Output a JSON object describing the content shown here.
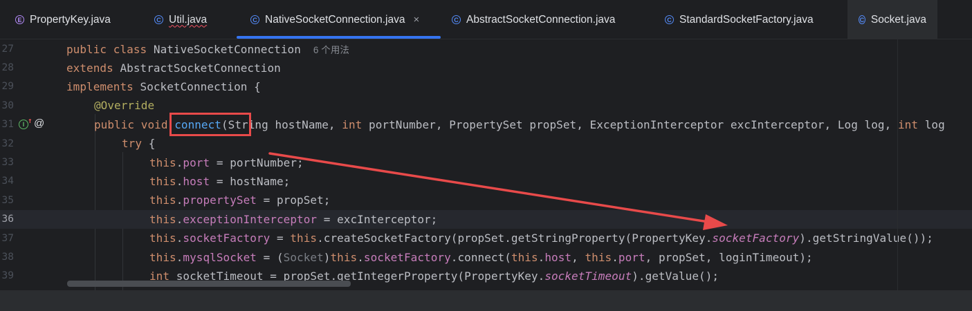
{
  "tabs": [
    {
      "label": "PropertyKey.java",
      "icon": "E",
      "kind": "enum"
    },
    {
      "label": "Util.java",
      "icon": "C",
      "kind": "class",
      "error": true
    },
    {
      "label": "NativeSocketConnection.java",
      "icon": "C",
      "kind": "class",
      "active": true,
      "close": "×"
    },
    {
      "label": "AbstractSocketConnection.java",
      "icon": "C",
      "kind": "class"
    },
    {
      "label": "StandardSocketFactory.java",
      "icon": "C",
      "kind": "class"
    },
    {
      "label": "Socket.java",
      "icon": "C",
      "kind": "class"
    }
  ],
  "gutter": {
    "implements_icon": "I",
    "override_marker": "↑",
    "annotation_icon": "@"
  },
  "hint_usages": "6 个用法",
  "lines": [
    {
      "num": "27",
      "t": {
        "a": "public class",
        "b": " NativeSocketConnection"
      }
    },
    {
      "num": "28",
      "t": {
        "a": "extends",
        "b": " AbstractSocketConnection"
      }
    },
    {
      "num": "29",
      "t": {
        "a": "implements",
        "b": " SocketConnection {"
      }
    },
    {
      "num": "30",
      "t": {
        "a": "@Override"
      }
    },
    {
      "num": "31",
      "t": {
        "a": "public void",
        "b": " ",
        "c": "connect",
        "d": "(String hostName, ",
        "e": "int",
        "f": " portNumber, PropertySet propSet, ExceptionInterceptor excInterceptor, Log log, ",
        "g": "int",
        "h": " log"
      }
    },
    {
      "num": "32",
      "t": {
        "a": "try",
        "b": " {"
      }
    },
    {
      "num": "33",
      "t": {
        "a": "this",
        "b": ".",
        "c": "port",
        "d": " = portNumber;"
      }
    },
    {
      "num": "34",
      "t": {
        "a": "this",
        "b": ".",
        "c": "host",
        "d": " = hostName;"
      }
    },
    {
      "num": "35",
      "t": {
        "a": "this",
        "b": ".",
        "c": "propertySet",
        "d": " = propSet;"
      }
    },
    {
      "num": "36",
      "t": {
        "a": "this",
        "b": ".",
        "c": "exceptionInterceptor",
        "d": " = excInterceptor;"
      }
    },
    {
      "num": "37",
      "t": {
        "a": "this",
        "b": ".",
        "c": "socketFactory",
        "d": " = ",
        "e": "this",
        "f": ".createSocketFactory(propSet.getStringProperty(PropertyKey.",
        "g": "socketFactory",
        "h": ").getStringValue());"
      }
    },
    {
      "num": "38",
      "t": {
        "a": "this",
        "b": ".",
        "c": "mysqlSocket",
        "d": " = (",
        "e": "Socket",
        "f": ")",
        "g": "this",
        "h": ".",
        "i": "socketFactory",
        "j": ".connect(",
        "k": "this",
        "l": ".",
        "m": "host",
        "n": ", ",
        "o": "this",
        "p": ".",
        "q": "port",
        "r": ", propSet, loginTimeout);"
      }
    },
    {
      "num": "39",
      "t": {
        "a": "int",
        "b": " socketTimeout = propSet.getIntegerProperty(PropertyKey.",
        "c": "socketTimeout",
        "d": ").getValue();"
      }
    }
  ],
  "colors": {
    "keyword": "#cf8e6d",
    "field": "#c77dbb",
    "method": "#56a8f5",
    "annotation": "#b3ae60",
    "highlight": "#e84a4a"
  }
}
